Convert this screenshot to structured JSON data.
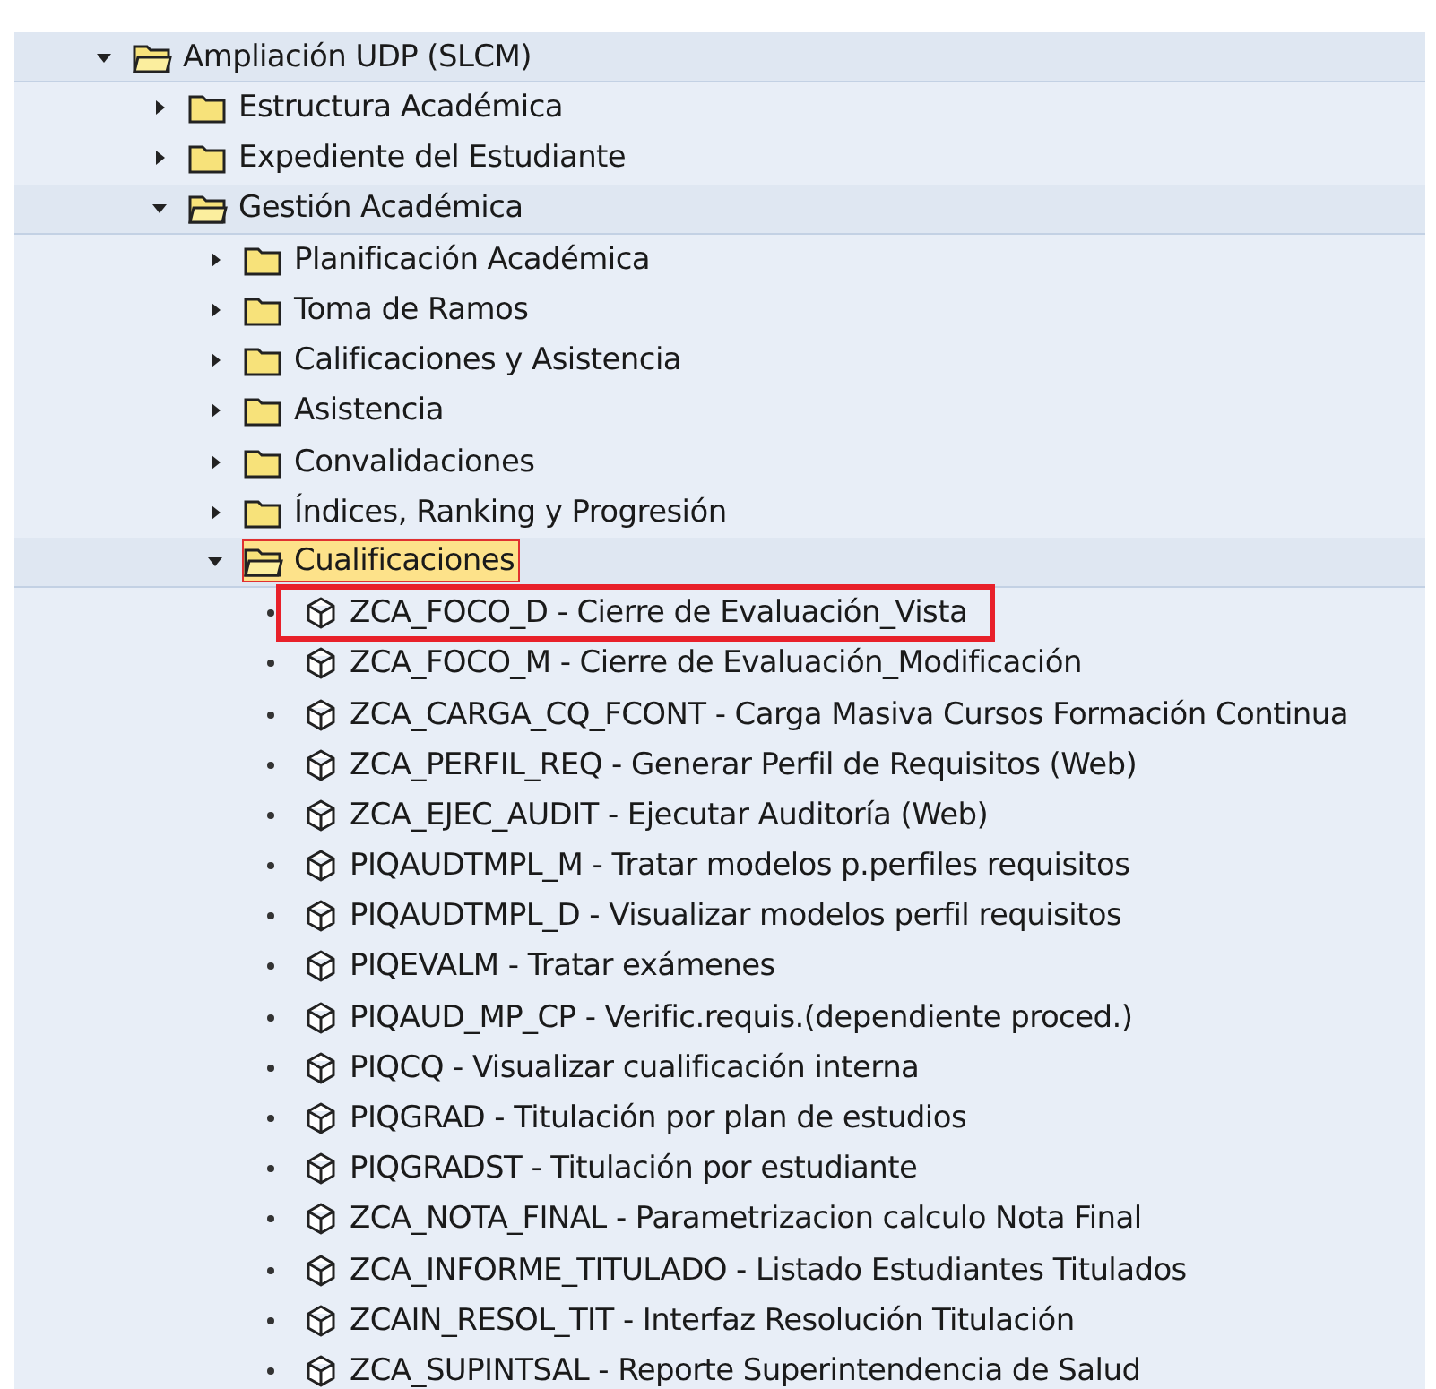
{
  "tree": [
    {
      "label": "Ampliación UDP (SLCM)",
      "kind": "folder",
      "expanded": true,
      "selected": false,
      "children": [
        {
          "label": "Estructura Académica",
          "kind": "folder",
          "expanded": false,
          "selected": false
        },
        {
          "label": "Expediente del Estudiante",
          "kind": "folder",
          "expanded": false,
          "selected": false
        },
        {
          "label": "Gestión Académica",
          "kind": "folder",
          "expanded": true,
          "selected": false,
          "children": [
            {
              "label": "Planificación Académica",
              "kind": "folder",
              "expanded": false,
              "selected": false
            },
            {
              "label": "Toma de Ramos",
              "kind": "folder",
              "expanded": false,
              "selected": false
            },
            {
              "label": "Calificaciones y Asistencia",
              "kind": "folder",
              "expanded": false,
              "selected": false
            },
            {
              "label": "Asistencia",
              "kind": "folder",
              "expanded": false,
              "selected": false
            },
            {
              "label": "Convalidaciones",
              "kind": "folder",
              "expanded": false,
              "selected": false
            },
            {
              "label": "Índices, Ranking y Progresión",
              "kind": "folder",
              "expanded": false,
              "selected": false
            },
            {
              "label": "Cualificaciones",
              "kind": "folder",
              "expanded": true,
              "selected": true,
              "children": [
                {
                  "label": "ZCA_FOCO_D - Cierre de Evaluación_Vista",
                  "kind": "transaction",
                  "highlighted": true
                },
                {
                  "label": "ZCA_FOCO_M - Cierre de Evaluación_Modificación",
                  "kind": "transaction",
                  "highlighted": false
                },
                {
                  "label": "ZCA_CARGA_CQ_FCONT - Carga Masiva Cursos Formación Continua",
                  "kind": "transaction",
                  "highlighted": false
                },
                {
                  "label": "ZCA_PERFIL_REQ - Generar Perfil de Requisitos (Web)",
                  "kind": "transaction",
                  "highlighted": false
                },
                {
                  "label": "ZCA_EJEC_AUDIT - Ejecutar Auditoría (Web)",
                  "kind": "transaction",
                  "highlighted": false
                },
                {
                  "label": "PIQAUDTMPL_M - Tratar modelos p.perfiles requisitos",
                  "kind": "transaction",
                  "highlighted": false
                },
                {
                  "label": "PIQAUDTMPL_D - Visualizar modelos perfil requisitos",
                  "kind": "transaction",
                  "highlighted": false
                },
                {
                  "label": "PIQEVALM - Tratar exámenes",
                  "kind": "transaction",
                  "highlighted": false
                },
                {
                  "label": "PIQAUD_MP_CP - Verific.requis.(dependiente proced.)",
                  "kind": "transaction",
                  "highlighted": false
                },
                {
                  "label": "PIQCQ - Visualizar cualificación interna",
                  "kind": "transaction",
                  "highlighted": false
                },
                {
                  "label": "PIQGRAD - Titulación por plan de estudios",
                  "kind": "transaction",
                  "highlighted": false
                },
                {
                  "label": "PIQGRADST - Titulación por estudiante",
                  "kind": "transaction",
                  "highlighted": false
                },
                {
                  "label": "ZCA_NOTA_FINAL - Parametrizacion calculo Nota Final",
                  "kind": "transaction",
                  "highlighted": false
                },
                {
                  "label": "ZCA_INFORME_TITULADO - Listado Estudiantes Titulados",
                  "kind": "transaction",
                  "highlighted": false
                },
                {
                  "label": "ZCAIN_RESOL_TIT - Interfaz Resolución Titulación",
                  "kind": "transaction",
                  "highlighted": false
                },
                {
                  "label": "ZCA_SUPINTSAL - Reporte Superintendencia de Salud",
                  "kind": "transaction",
                  "highlighted": false
                }
              ]
            }
          ]
        }
      ]
    }
  ]
}
